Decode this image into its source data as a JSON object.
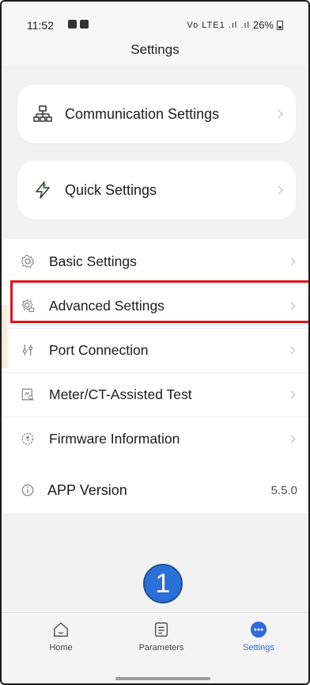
{
  "status_bar": {
    "time": "11:52",
    "right_text": "26%",
    "signal_text": "Vo LTE1 .ıl .ıl"
  },
  "header": {
    "title": "Settings"
  },
  "cards": [
    {
      "label": "Communication Settings",
      "icon": "network-icon"
    },
    {
      "label": "Quick Settings",
      "icon": "lightning-icon"
    }
  ],
  "list": [
    {
      "label": "Basic Settings",
      "icon": "gear-icon"
    },
    {
      "label": "Advanced Settings",
      "icon": "advanced-gear-icon",
      "highlighted": true
    },
    {
      "label": "Port Connection",
      "icon": "port-icon"
    },
    {
      "label": "Meter/CT-Assisted Test",
      "icon": "meter-test-icon"
    },
    {
      "label": "Firmware Information",
      "icon": "firmware-icon"
    }
  ],
  "version": {
    "label": "APP Version",
    "value": "5.5.0",
    "icon": "info-icon"
  },
  "annotation": {
    "step": "1",
    "color": "#2c6fd6"
  },
  "highlight_color": "#e3121b",
  "tabs": [
    {
      "label": "Home",
      "icon": "home-icon"
    },
    {
      "label": "Parameters",
      "icon": "document-icon"
    },
    {
      "label": "Settings",
      "icon": "more-icon",
      "active": true
    }
  ],
  "accent_color": "#2f6bd8"
}
